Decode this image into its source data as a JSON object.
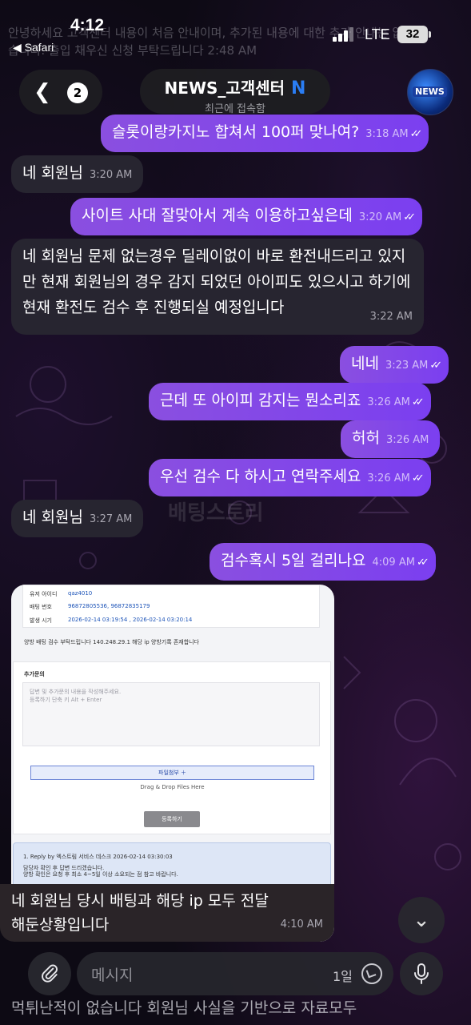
{
  "status_bar": {
    "time": "4:12",
    "back_app": "◀ Safari",
    "network": "LTE",
    "battery": "32"
  },
  "header": {
    "back_count": "2",
    "title": "NEWS_고객센터",
    "title_logo": "N",
    "subtitle": "최근에 접속함",
    "avatar_text": "NEWS"
  },
  "top_peek": "안녕하세요 고객센터 내용이 처음 안내이며, 추가된 내용에 대한 추가 안내는 없습니다. 출입 채우신 신청 부탁드립니다 2:48 AM",
  "messages": [
    {
      "side": "out",
      "text": "슬롯이랑카지노 합쳐서 100퍼 맞나여?",
      "time": "3:18 AM"
    },
    {
      "side": "in",
      "text": "네 회원님",
      "time": "3:20 AM"
    },
    {
      "side": "out",
      "text": "사이트 사대 잘맞아서 계속 이용하고싶은데",
      "time": "3:20 AM"
    },
    {
      "side": "in",
      "text": "네 회원님 문제 없는경우 딜레이없이 바로 환전내드리고 있지만 현재 회원님의 경우 감지 되었던 아이피도 있으시고 하기에 현재 환전도 검수 후 진행되실 예정입니다",
      "time": "3:22 AM"
    },
    {
      "side": "out",
      "text": "네네",
      "time": "3:23 AM"
    },
    {
      "side": "out",
      "text": "근데 또 아이피 감지는 뭔소리죠",
      "time": "3:26 AM"
    },
    {
      "side": "out",
      "text": "허허",
      "time": "3:26 AM"
    },
    {
      "side": "out",
      "text": "우선 검수 다 하시고 연락주세요",
      "time": "3:26 AM"
    },
    {
      "side": "in",
      "text": "네 회원님",
      "time": "3:27 AM"
    },
    {
      "side": "out",
      "text": "검수혹시 5일 걸리나요",
      "time": "4:09 AM"
    }
  ],
  "screenshot": {
    "user_id_label": "유저 아이디",
    "user_id": "qaz4010",
    "bet_no_label": "배팅 번호",
    "bet_no": "96872805536, 96872835179",
    "time_label": "발생 시기",
    "time_value": "2026-02-14 03:19:54 , 2026-02-14 03:20:14",
    "notice": "양방 배팅 검수 부탁드립니다 140.248.29.1 해당 ip 양방기록 존재합니다",
    "inquiry_label": "추가문의",
    "textarea_placeholder": "답변 및 추가문의 내용을 작성해주세요.",
    "textarea_hint": "등록하기 단축 키 Alt + Enter",
    "attach_label": "파일첨부 ＋",
    "dragdrop": "Drag & Drop Files Here",
    "register": "등록하기",
    "reply_title": "1.  Reply by 엑스트림 서비스 데스크 2026-02-14 03:30:03",
    "reply_line1": "담당자 확인 후 답변 드리겠습니다.",
    "reply_line2": "양방 확인은 요청 후 최소 4~5일 이상 소요되는 점 참고 바랍니다."
  },
  "overlay_message": {
    "text_line1": "네 회원님 당시 배팅과 해당 ip 모두 전달",
    "text_line2": "해둔상황입니다",
    "time": "4:10 AM"
  },
  "watermark": "배팅스토리",
  "input": {
    "placeholder": "메시지",
    "ttl": "1일"
  },
  "bottom_peek": "먹튀난적이 없습니다 회원님 사실을 기반으로 자료모두"
}
